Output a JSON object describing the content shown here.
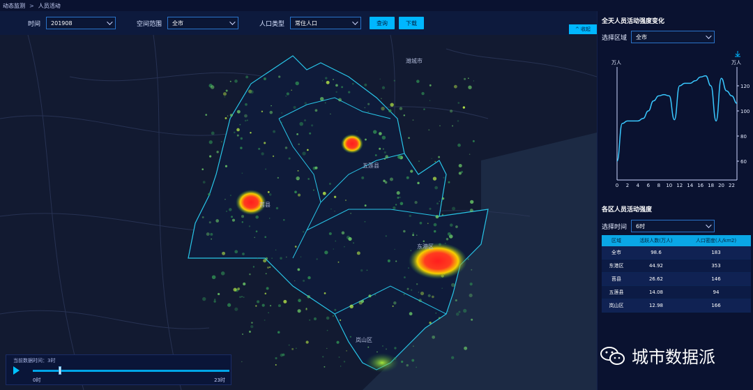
{
  "breadcrumb": {
    "root": "动态监测",
    "separator": ">",
    "current": "人员活动"
  },
  "filters": {
    "time_label": "时间",
    "time_value": "201908",
    "space_label": "空间范围",
    "space_value": "全市",
    "population_label": "人口类型",
    "population_value": "常住人口",
    "query_button": "查询",
    "download_button": "下载"
  },
  "map": {
    "collapse_label": "^ 收起",
    "city_labels": [
      "潍城市",
      "五莲县",
      "莒县",
      "东港区",
      "岚山区"
    ],
    "hotspot_color": "#ff1e1e"
  },
  "player": {
    "label": "当前数据时间：3时",
    "start": "0时",
    "end": "23时",
    "position": 0.13
  },
  "panel1": {
    "title": "全天人员活动强度变化",
    "select_label": "选择区域",
    "select_value": "全市",
    "left_unit": "万人",
    "right_unit": "万人"
  },
  "chart_data": {
    "type": "line",
    "title": "全天人员活动强度变化",
    "x": [
      0,
      1,
      2,
      3,
      4,
      5,
      6,
      7,
      8,
      9,
      10,
      11,
      12,
      13,
      14,
      15,
      16,
      17,
      18,
      19,
      20,
      21,
      22,
      23
    ],
    "x_ticks": [
      "0",
      "2",
      "4",
      "6",
      "8",
      "10",
      "12",
      "14",
      "16",
      "18",
      "20",
      "22"
    ],
    "y_right_ticks": [
      "60",
      "80",
      "100",
      "120"
    ],
    "y_right_range": [
      45,
      135
    ],
    "series": [
      {
        "values": [
          60,
          90,
          92,
          92,
          92,
          94,
          100,
          108,
          112,
          113,
          112,
          93,
          120,
          122,
          122,
          124,
          127,
          128,
          120,
          92,
          126,
          116,
          112,
          106
        ]
      }
    ],
    "line_color": "#39c8ff"
  },
  "panel2": {
    "title": "各区人员活动强度",
    "select_label": "选择时间",
    "select_value": "6时",
    "table": {
      "headers": [
        "区域",
        "活跃人数(万人)",
        "人口密度(人/km2)"
      ],
      "rows": [
        [
          "全市",
          "98.6",
          "183"
        ],
        [
          "东港区",
          "44.92",
          "353"
        ],
        [
          "莒县",
          "26.62",
          "146"
        ],
        [
          "五莲县",
          "14.08",
          "94"
        ],
        [
          "岚山区",
          "12.98",
          "166"
        ]
      ]
    }
  },
  "watermark": {
    "text": "城市数据派"
  },
  "colors": {
    "accent": "#00b7ff",
    "panel_bg": "#0a1230"
  }
}
